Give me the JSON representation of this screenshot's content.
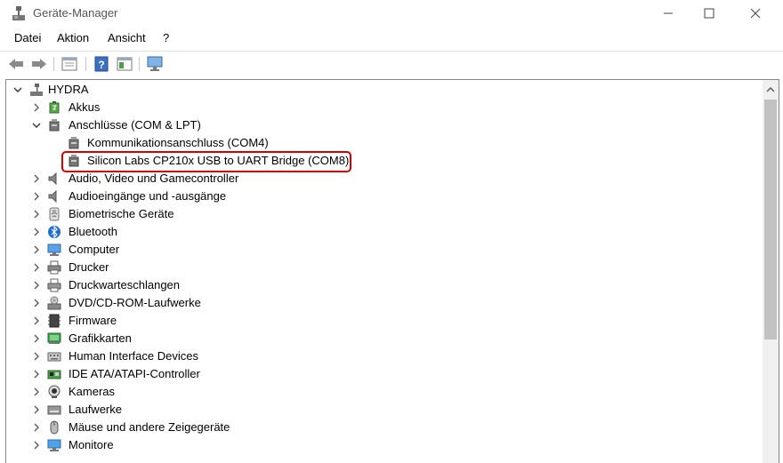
{
  "window": {
    "title": "Geräte-Manager"
  },
  "menu": [
    "Datei",
    "Aktion",
    "Ansicht",
    "?"
  ],
  "toolbar_icons": [
    "back-icon",
    "forward-icon",
    "properties-pane-icon",
    "help-icon",
    "details-pane-icon",
    "monitor-scan-icon"
  ],
  "tree": {
    "root": "HYDRA",
    "expanded_category": "Anschlüsse (COM & LPT)",
    "first": {
      "label": "Akkus",
      "icon": "battery-icon"
    },
    "ports": [
      {
        "label": "Kommunikationsanschluss (COM4)",
        "icon": "port-icon"
      },
      {
        "label": "Silicon Labs CP210x USB to UART Bridge (COM8)",
        "icon": "port-icon",
        "highlighted": true
      }
    ],
    "categories": [
      {
        "label": "Audio, Video und Gamecontroller",
        "icon": "speaker-icon"
      },
      {
        "label": "Audioeingänge und -ausgänge",
        "icon": "speaker-icon"
      },
      {
        "label": "Biometrische Geräte",
        "icon": "fingerprint-icon"
      },
      {
        "label": "Bluetooth",
        "icon": "bluetooth-icon"
      },
      {
        "label": "Computer",
        "icon": "computer-icon"
      },
      {
        "label": "Drucker",
        "icon": "printer-icon"
      },
      {
        "label": "Druckwarteschlangen",
        "icon": "printer-queue-icon"
      },
      {
        "label": "DVD/CD-ROM-Laufwerke",
        "icon": "dvd-drive-icon"
      },
      {
        "label": "Firmware",
        "icon": "firmware-icon"
      },
      {
        "label": "Grafikkarten",
        "icon": "display-adapter-icon"
      },
      {
        "label": "Human Interface Devices",
        "icon": "keyboard-icon"
      },
      {
        "label": "IDE ATA/ATAPI-Controller",
        "icon": "ide-controller-icon"
      },
      {
        "label": "Kameras",
        "icon": "camera-icon"
      },
      {
        "label": "Laufwerke",
        "icon": "disk-drive-icon"
      },
      {
        "label": "Mäuse und andere Zeigegeräte",
        "icon": "mouse-icon"
      },
      {
        "label": "Monitore",
        "icon": "monitor-icon"
      }
    ]
  },
  "colors": {
    "highlight_border": "#d40000",
    "accent_blue": "#2b7bd6"
  }
}
